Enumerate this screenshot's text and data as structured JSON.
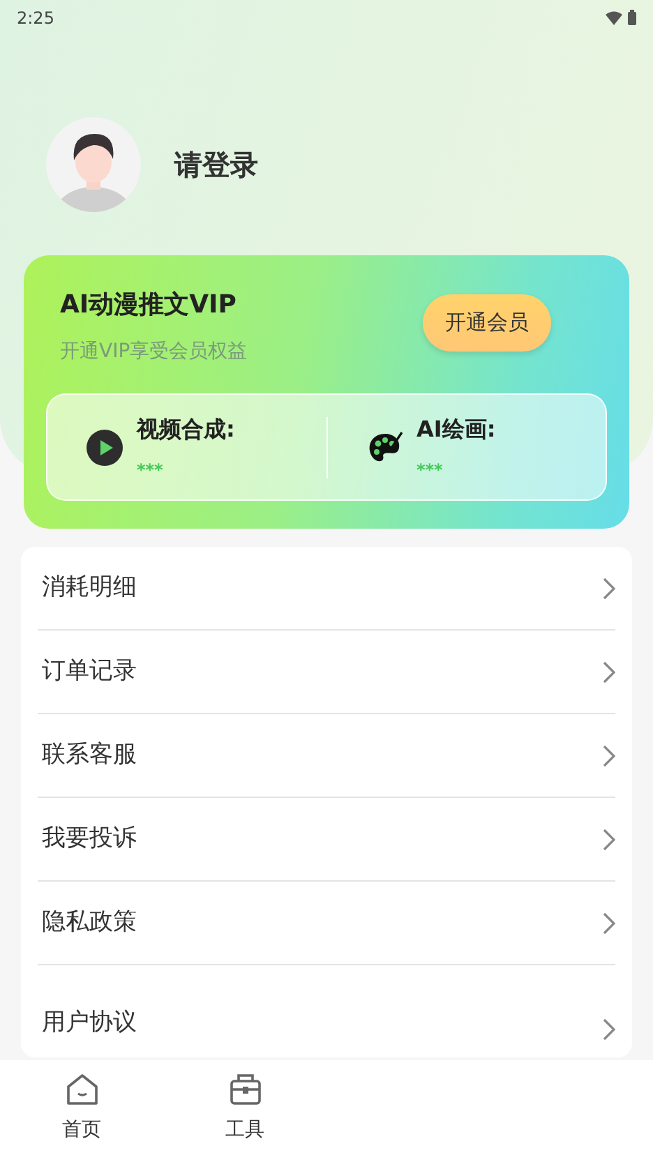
{
  "status_bar": {
    "time": "2:25"
  },
  "profile": {
    "name": "请登录"
  },
  "vip_card": {
    "title": "AI动漫推文VIP",
    "subtitle": "开通VIP享受会员权益",
    "button": "开通会员",
    "benefits": [
      {
        "kind": "video",
        "label": "视频合成:",
        "value": "***"
      },
      {
        "kind": "paint",
        "label": "AI绘画:",
        "value": "***"
      }
    ]
  },
  "menu": [
    "消耗明细",
    "订单记录",
    "联系客服",
    "我要投诉",
    "隐私政策",
    "用户协议"
  ],
  "tab_bar": [
    {
      "kind": "home",
      "label": "首页"
    },
    {
      "kind": "tools",
      "label": "工具"
    }
  ]
}
